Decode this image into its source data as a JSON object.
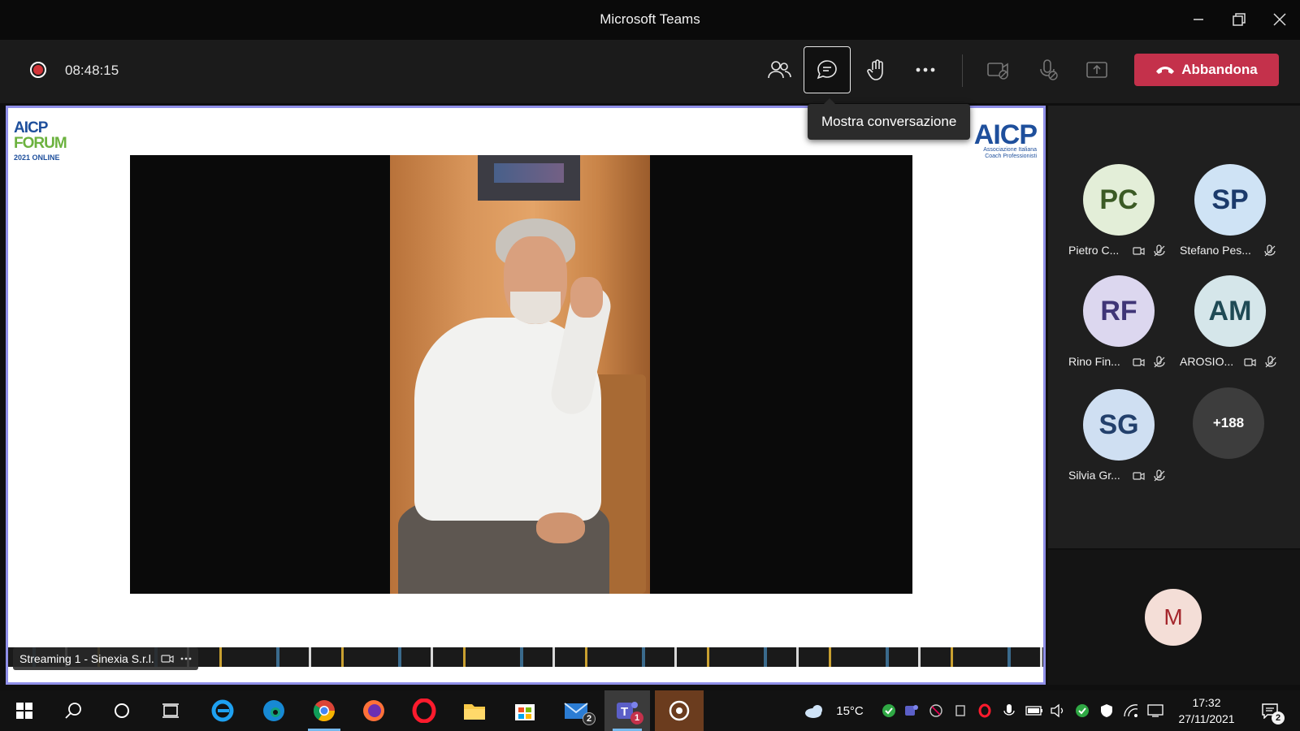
{
  "window": {
    "title": "Microsoft Teams"
  },
  "toolbar": {
    "timer": "08:48:15",
    "leave_label": "Abbandona",
    "tooltip": "Mostra conversazione"
  },
  "stage": {
    "logo_left_line1": "AICP",
    "logo_left_line2": "FORUM",
    "logo_left_line3": "2021 ONLINE",
    "logo_right_line1": "AICP",
    "logo_right_line2": "Associazione Italiana",
    "logo_right_line3": "Coach Professionisti",
    "stream_label": "Streaming 1 - Sinexia S.r.l."
  },
  "participants": [
    {
      "initials": "PC",
      "name": "Pietro C...",
      "bg": "#e3eed8",
      "fg": "#3b5a24"
    },
    {
      "initials": "SP",
      "name": "Stefano Pes...",
      "bg": "#cfe3f5",
      "fg": "#1b3a6b"
    },
    {
      "initials": "RF",
      "name": "Rino Fin...",
      "bg": "#dcd7ef",
      "fg": "#3f3577"
    },
    {
      "initials": "AM",
      "name": "AROSIO...",
      "bg": "#d5e6ea",
      "fg": "#1f4a55"
    },
    {
      "initials": "SG",
      "name": "Silvia Gr...",
      "bg": "#cfdff2",
      "fg": "#23406c"
    }
  ],
  "more_participants": "+188",
  "self_avatar": "M",
  "taskbar": {
    "weather_temp": "15°C",
    "time": "17:32",
    "date": "27/11/2021",
    "mail_badge": "2",
    "teams_badge": "1",
    "notifications_badge": "2"
  }
}
